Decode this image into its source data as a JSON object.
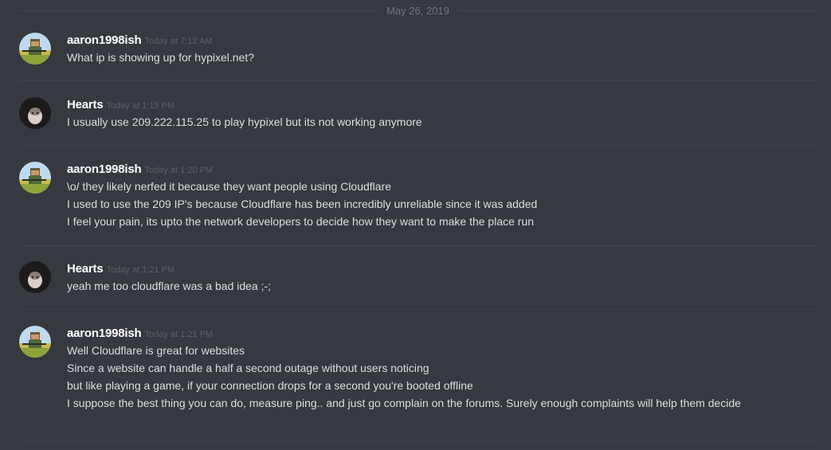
{
  "date_divider": "May 26, 2019",
  "messages": [
    {
      "username": "aaron1998ish",
      "timestamp": "Today at 7:12 AM",
      "avatar_icon": "pixel-soldier-avatar",
      "lines": [
        "What ip is showing up for hypixel.net?"
      ]
    },
    {
      "username": "Hearts",
      "timestamp": "Today at 1:15 PM",
      "avatar_icon": "cat-photo-avatar",
      "lines": [
        "I usually use 209.222.115.25 to play hypixel but its not working anymore"
      ]
    },
    {
      "username": "aaron1998ish",
      "timestamp": "Today at 1:20 PM",
      "avatar_icon": "pixel-soldier-avatar",
      "lines": [
        "\\o/ they likely nerfed it because they want people using Cloudflare",
        "I used to use the 209 IP's because Cloudflare has been incredibly unreliable since it was added",
        "I feel your pain, its upto the network developers to decide how they want to make the place run"
      ]
    },
    {
      "username": "Hearts",
      "timestamp": "Today at 1:21 PM",
      "avatar_icon": "cat-photo-avatar",
      "lines": [
        "yeah me too cloudflare was a bad idea ;-;"
      ]
    },
    {
      "username": "aaron1998ish",
      "timestamp": "Today at 1:21 PM",
      "avatar_icon": "pixel-soldier-avatar",
      "lines": [
        "Well Cloudflare is great for websites",
        "Since a website can handle a half a second outage without users noticing",
        "but like playing a game, if your connection drops for a second you're booted offline",
        "I suppose the best thing you can do, measure ping.. and just go complain on the forums. Surely enough complaints will help them decide"
      ]
    }
  ]
}
